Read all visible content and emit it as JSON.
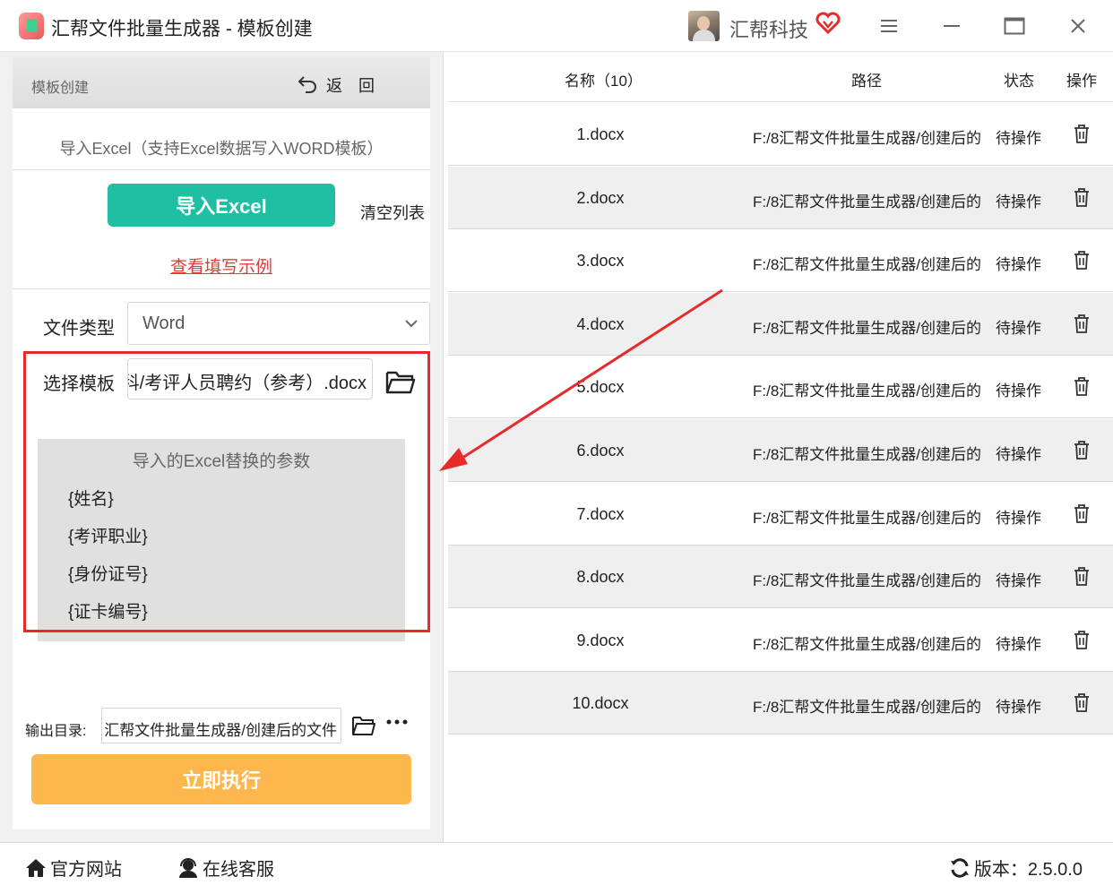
{
  "window": {
    "title": "汇帮文件批量生成器 - 模板创建",
    "company": "汇帮科技"
  },
  "left": {
    "header_title": "模板创建",
    "back_label": "返回",
    "import_desc": "导入Excel（支持Excel数据写入WORD模板）",
    "import_button": "导入Excel",
    "clear_button": "清空列表",
    "example_link": "查看填写示例",
    "file_type_label": "文件类型",
    "file_type_value": "Word",
    "template_label": "选择模板",
    "template_value": "科/考评人员聘约（参考）.docx",
    "params_title": "导入的Excel替换的参数",
    "params": [
      "{姓名}",
      "{考评职业}",
      "{身份证号}",
      "{证卡编号}"
    ],
    "output_label": "输出目录:",
    "output_value": "汇帮文件批量生成器/创建后的文件",
    "run_button": "立即执行"
  },
  "table": {
    "headers": {
      "name": "名称（10）",
      "path": "路径",
      "status": "状态",
      "action": "操作"
    },
    "rows": [
      {
        "name": "1.docx",
        "path": "F:/8汇帮文件批量生成器/创建后的",
        "status": "待操作"
      },
      {
        "name": "2.docx",
        "path": "F:/8汇帮文件批量生成器/创建后的",
        "status": "待操作"
      },
      {
        "name": "3.docx",
        "path": "F:/8汇帮文件批量生成器/创建后的",
        "status": "待操作"
      },
      {
        "name": "4.docx",
        "path": "F:/8汇帮文件批量生成器/创建后的",
        "status": "待操作"
      },
      {
        "name": "5.docx",
        "path": "F:/8汇帮文件批量生成器/创建后的",
        "status": "待操作"
      },
      {
        "name": "6.docx",
        "path": "F:/8汇帮文件批量生成器/创建后的",
        "status": "待操作"
      },
      {
        "name": "7.docx",
        "path": "F:/8汇帮文件批量生成器/创建后的",
        "status": "待操作"
      },
      {
        "name": "8.docx",
        "path": "F:/8汇帮文件批量生成器/创建后的",
        "status": "待操作"
      },
      {
        "name": "9.docx",
        "path": "F:/8汇帮文件批量生成器/创建后的",
        "status": "待操作"
      },
      {
        "name": "10.docx",
        "path": "F:/8汇帮文件批量生成器/创建后的",
        "status": "待操作"
      }
    ]
  },
  "footer": {
    "website": "官方网站",
    "support": "在线客服",
    "version": "版本：2.5.0.0"
  },
  "colors": {
    "import_button": "#1fbfa3",
    "run_button": "#fdb74d",
    "highlight_frame": "#e62b2b",
    "link": "#e53a3a"
  }
}
